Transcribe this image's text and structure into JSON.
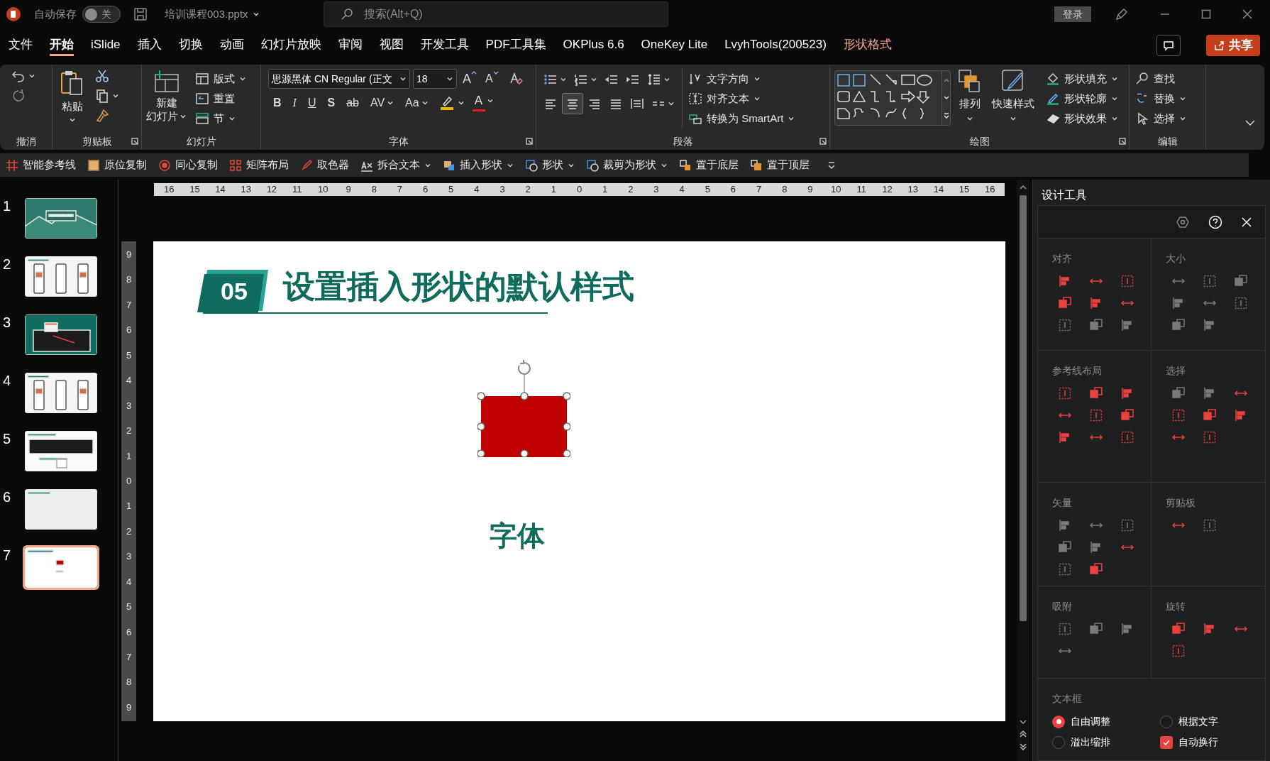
{
  "title_bar": {
    "autosave_label": "自动保存",
    "autosave": {
      "label": "关",
      "on": false
    },
    "file_name": "培训课程003.pptx",
    "search_placeholder": "搜索(Alt+Q)",
    "login": "登录"
  },
  "menu_tabs": [
    {
      "label": "文件",
      "selected": false,
      "kind": "normal"
    },
    {
      "label": "开始",
      "selected": true,
      "kind": "normal"
    },
    {
      "label": "iSlide",
      "selected": false,
      "kind": "normal"
    },
    {
      "label": "插入",
      "selected": false,
      "kind": "normal"
    },
    {
      "label": "切换",
      "selected": false,
      "kind": "normal"
    },
    {
      "label": "动画",
      "selected": false,
      "kind": "normal"
    },
    {
      "label": "幻灯片放映",
      "selected": false,
      "kind": "normal"
    },
    {
      "label": "审阅",
      "selected": false,
      "kind": "normal"
    },
    {
      "label": "视图",
      "selected": false,
      "kind": "normal"
    },
    {
      "label": "开发工具",
      "selected": false,
      "kind": "normal"
    },
    {
      "label": "PDF工具集",
      "selected": false,
      "kind": "normal"
    },
    {
      "label": "OKPlus 6.6",
      "selected": false,
      "kind": "normal"
    },
    {
      "label": "OneKey Lite",
      "selected": false,
      "kind": "normal"
    },
    {
      "label": "LvyhTools(200523)",
      "selected": false,
      "kind": "normal"
    },
    {
      "label": "形状格式",
      "selected": false,
      "kind": "contextual"
    }
  ],
  "share_button": "共享",
  "ribbon": {
    "undo": {
      "label": "撤消"
    },
    "clipboard": {
      "label": "剪贴板",
      "paste": "粘贴"
    },
    "slides": {
      "label": "幻灯片",
      "new_slide_lines": [
        "新建",
        "幻灯片"
      ],
      "layout": "版式",
      "reset": "重置",
      "section": "节"
    },
    "font": {
      "label": "字体",
      "font_name": "思源黑体 CN Regular (正文",
      "font_size": "18",
      "grow": "A",
      "shrink": "A",
      "format_buttons": [
        {
          "text": "B",
          "kind": "bold"
        },
        {
          "text": "I",
          "kind": "italic"
        },
        {
          "text": "U",
          "kind": "underline"
        },
        {
          "text": "S",
          "kind": "shadow"
        },
        {
          "text": "ab",
          "kind": "strike"
        },
        {
          "text": "AV",
          "kind": "spacing"
        },
        {
          "text": "Aa",
          "kind": "case"
        }
      ],
      "font_color": "A"
    },
    "paragraph": {
      "label": "段落",
      "text_direction": "文字方向",
      "align_text": "对齐文本",
      "smartart": "转换为 SmartArt"
    },
    "drawing": {
      "label": "绘图",
      "arrange": "排列",
      "quick_styles": "快速样式",
      "fill": "形状填充",
      "outline": "形状轮廓",
      "effects": "形状效果"
    },
    "editing": {
      "label": "编辑",
      "find": "查找",
      "replace": "替换",
      "select": "选择"
    }
  },
  "quick_toolbar": [
    {
      "label": "智能参考线",
      "dropdown": false
    },
    {
      "label": "原位复制",
      "dropdown": false
    },
    {
      "label": "同心复制",
      "dropdown": false
    },
    {
      "label": "矩阵布局",
      "dropdown": false
    },
    {
      "label": "取色器",
      "dropdown": false
    },
    {
      "label": "拆合文本",
      "dropdown": true
    },
    {
      "label": "插入形状",
      "dropdown": true
    },
    {
      "label": "形状",
      "dropdown": true
    },
    {
      "label": "裁剪为形状",
      "dropdown": true
    },
    {
      "label": "置于底层",
      "dropdown": false
    },
    {
      "label": "置于顶层",
      "dropdown": false
    }
  ],
  "thumbnails": [
    {
      "number": "1",
      "selected": false,
      "kind": "cover"
    },
    {
      "number": "2",
      "selected": false,
      "kind": "phones"
    },
    {
      "number": "3",
      "selected": false,
      "kind": "screen-teal"
    },
    {
      "number": "4",
      "selected": false,
      "kind": "phones"
    },
    {
      "number": "5",
      "selected": false,
      "kind": "screen"
    },
    {
      "number": "6",
      "selected": false,
      "kind": "blank"
    },
    {
      "number": "7",
      "selected": true,
      "kind": "shape"
    }
  ],
  "ruler": {
    "horizontal": [
      "16",
      "15",
      "14",
      "13",
      "12",
      "11",
      "10",
      "9",
      "8",
      "7",
      "6",
      "5",
      "4",
      "3",
      "2",
      "1",
      "0",
      "1",
      "2",
      "3",
      "4",
      "5",
      "6",
      "7",
      "8",
      "9",
      "10",
      "11",
      "12",
      "13",
      "14",
      "15",
      "16"
    ],
    "vertical": [
      "9",
      "8",
      "7",
      "6",
      "5",
      "4",
      "3",
      "2",
      "1",
      "0",
      "1",
      "2",
      "3",
      "4",
      "5",
      "6",
      "7",
      "8",
      "9"
    ]
  },
  "slide": {
    "number_badge": "05",
    "title": "设置插入形状的默认样式",
    "body_text": "字体"
  },
  "design_panel": {
    "title": "设计工具",
    "sections": [
      {
        "title": "对齐",
        "tools": [
          {
            "disabled": false
          },
          {
            "disabled": false
          },
          {
            "disabled": false
          },
          {
            "disabled": false
          },
          {
            "disabled": false
          },
          {
            "disabled": false
          },
          {
            "disabled": true
          },
          {
            "disabled": true
          },
          {
            "disabled": true
          }
        ]
      },
      {
        "title": "大小",
        "tools": [
          {
            "disabled": true
          },
          {
            "disabled": true
          },
          {
            "disabled": true
          },
          {
            "disabled": true
          },
          {
            "disabled": true
          },
          {
            "disabled": true
          },
          {
            "disabled": true
          },
          {
            "disabled": true
          }
        ]
      },
      {
        "title": "参考线布局",
        "tools": [
          {
            "disabled": false
          },
          {
            "disabled": false
          },
          {
            "disabled": false
          },
          {
            "disabled": false
          },
          {
            "disabled": false
          },
          {
            "disabled": false
          },
          {
            "disabled": false
          },
          {
            "disabled": false
          },
          {
            "disabled": false
          }
        ]
      },
      {
        "title": "选择",
        "tools": [
          {
            "disabled": true
          },
          {
            "disabled": true
          },
          {
            "disabled": false
          },
          {
            "disabled": false
          },
          {
            "disabled": false
          },
          {
            "disabled": false
          },
          {
            "disabled": false
          },
          {
            "disabled": false
          }
        ]
      },
      {
        "title": "矢量",
        "tools": [
          {
            "disabled": true
          },
          {
            "disabled": true
          },
          {
            "disabled": true
          },
          {
            "disabled": true
          },
          {
            "disabled": true
          },
          {
            "disabled": false
          },
          {
            "disabled": true
          },
          {
            "disabled": false
          }
        ]
      },
      {
        "title": "剪贴板",
        "tools": [
          {
            "disabled": false
          },
          {
            "disabled": true
          }
        ]
      },
      {
        "title": "吸附",
        "tools": [
          {
            "disabled": true
          },
          {
            "disabled": true
          },
          {
            "disabled": true
          },
          {
            "disabled": true
          }
        ]
      },
      {
        "title": "旋转",
        "tools": [
          {
            "disabled": false
          },
          {
            "disabled": false
          },
          {
            "disabled": false
          },
          {
            "disabled": false
          }
        ]
      }
    ],
    "textbox": {
      "title": "文本框",
      "options": [
        {
          "label": "自由调整",
          "kind": "radio",
          "selected": true
        },
        {
          "label": "根据文字",
          "kind": "radio",
          "selected": false
        },
        {
          "label": "溢出缩排",
          "kind": "radio",
          "selected": false
        },
        {
          "label": "自动换行",
          "kind": "checkbox",
          "checked": true
        }
      ]
    }
  }
}
